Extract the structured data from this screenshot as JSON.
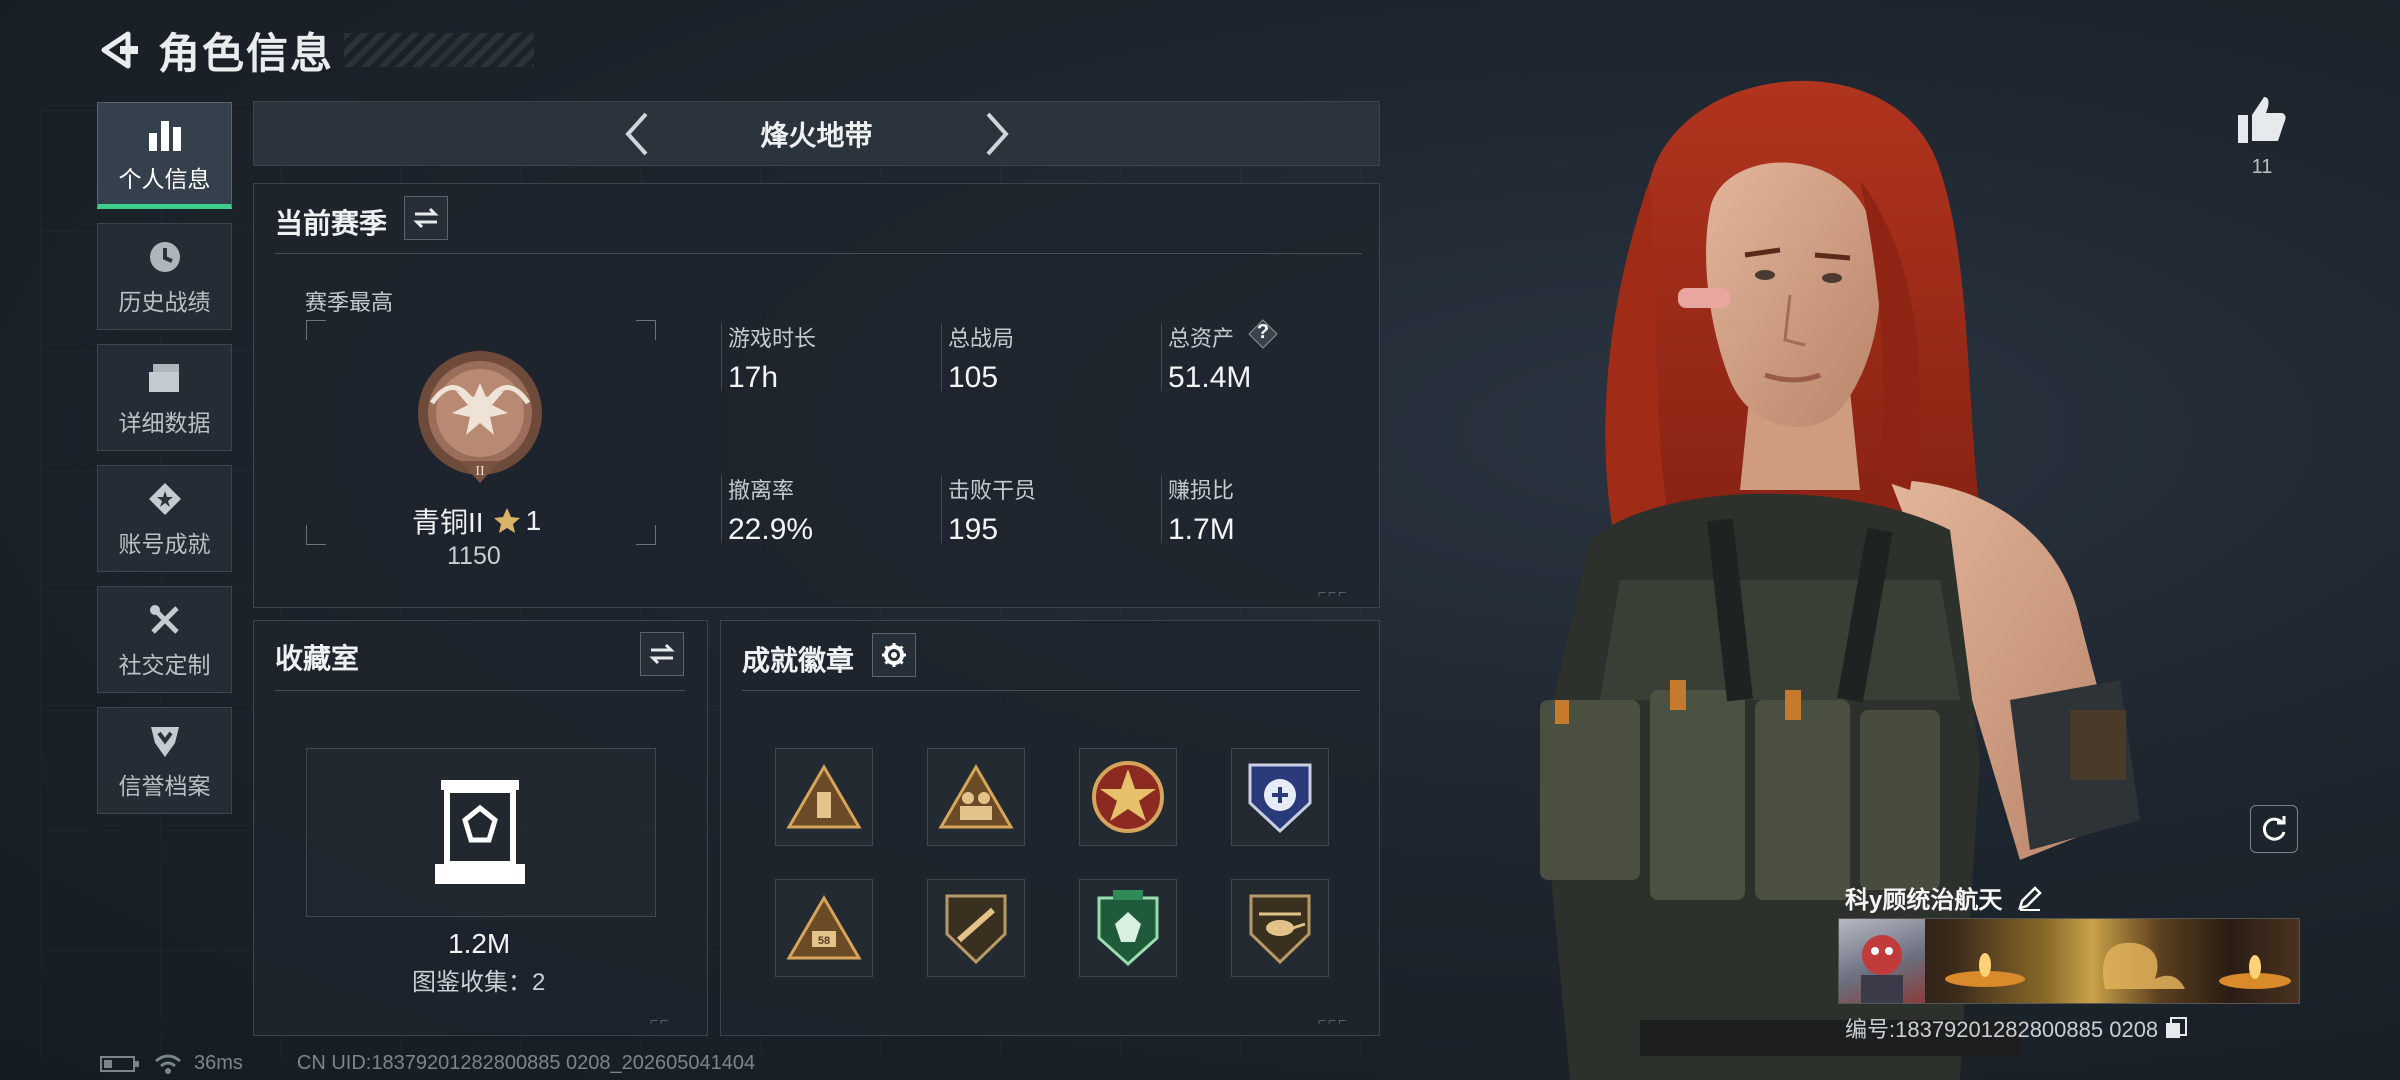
{
  "header": {
    "title": "角色信息"
  },
  "nav": {
    "items": [
      {
        "label": "个人信息",
        "icon": "bar-chart-icon",
        "active": true
      },
      {
        "label": "历史战绩",
        "icon": "clock-icon"
      },
      {
        "label": "详细数据",
        "icon": "folders-icon"
      },
      {
        "label": "账号成就",
        "icon": "achievement-icon"
      },
      {
        "label": "社交定制",
        "icon": "tools-icon"
      },
      {
        "label": "信誉档案",
        "icon": "shield-icon"
      }
    ]
  },
  "mode": {
    "name": "烽火地带"
  },
  "season": {
    "title": "当前赛季",
    "best_label": "赛季最高",
    "rank_name": "青铜II",
    "rank_stars": "1",
    "rank_score": "1150",
    "stats": [
      {
        "label": "游戏时长",
        "value": "17h"
      },
      {
        "label": "总战局",
        "value": "105"
      },
      {
        "label": "总资产",
        "value": "51.4M",
        "help": "?"
      },
      {
        "label": "撤离率",
        "value": "22.9%"
      },
      {
        "label": "击败干员",
        "value": "195"
      },
      {
        "label": "赚损比",
        "value": "1.7M"
      }
    ]
  },
  "collection": {
    "title": "收藏室",
    "value": "1.2M",
    "codex": "图鉴收集：2"
  },
  "achievements": {
    "title": "成就徽章",
    "badges": [
      "badge-triangle-ammo",
      "badge-triangle-soldiers",
      "badge-star-medal",
      "badge-shield-emblem",
      "badge-triangle-58",
      "badge-shield-rifle",
      "badge-green-crest",
      "badge-helicopter"
    ]
  },
  "status": {
    "ping": "36ms",
    "uid_text": "CN UID:18379201282800885 0208_202605041404"
  },
  "profile": {
    "likes": "11",
    "player_name": "科y顾统治航天",
    "id_text": "编号:18379201282800885 0208"
  },
  "colors": {
    "accent_green": "#3cd08a",
    "panel_border": "#3a444e"
  }
}
